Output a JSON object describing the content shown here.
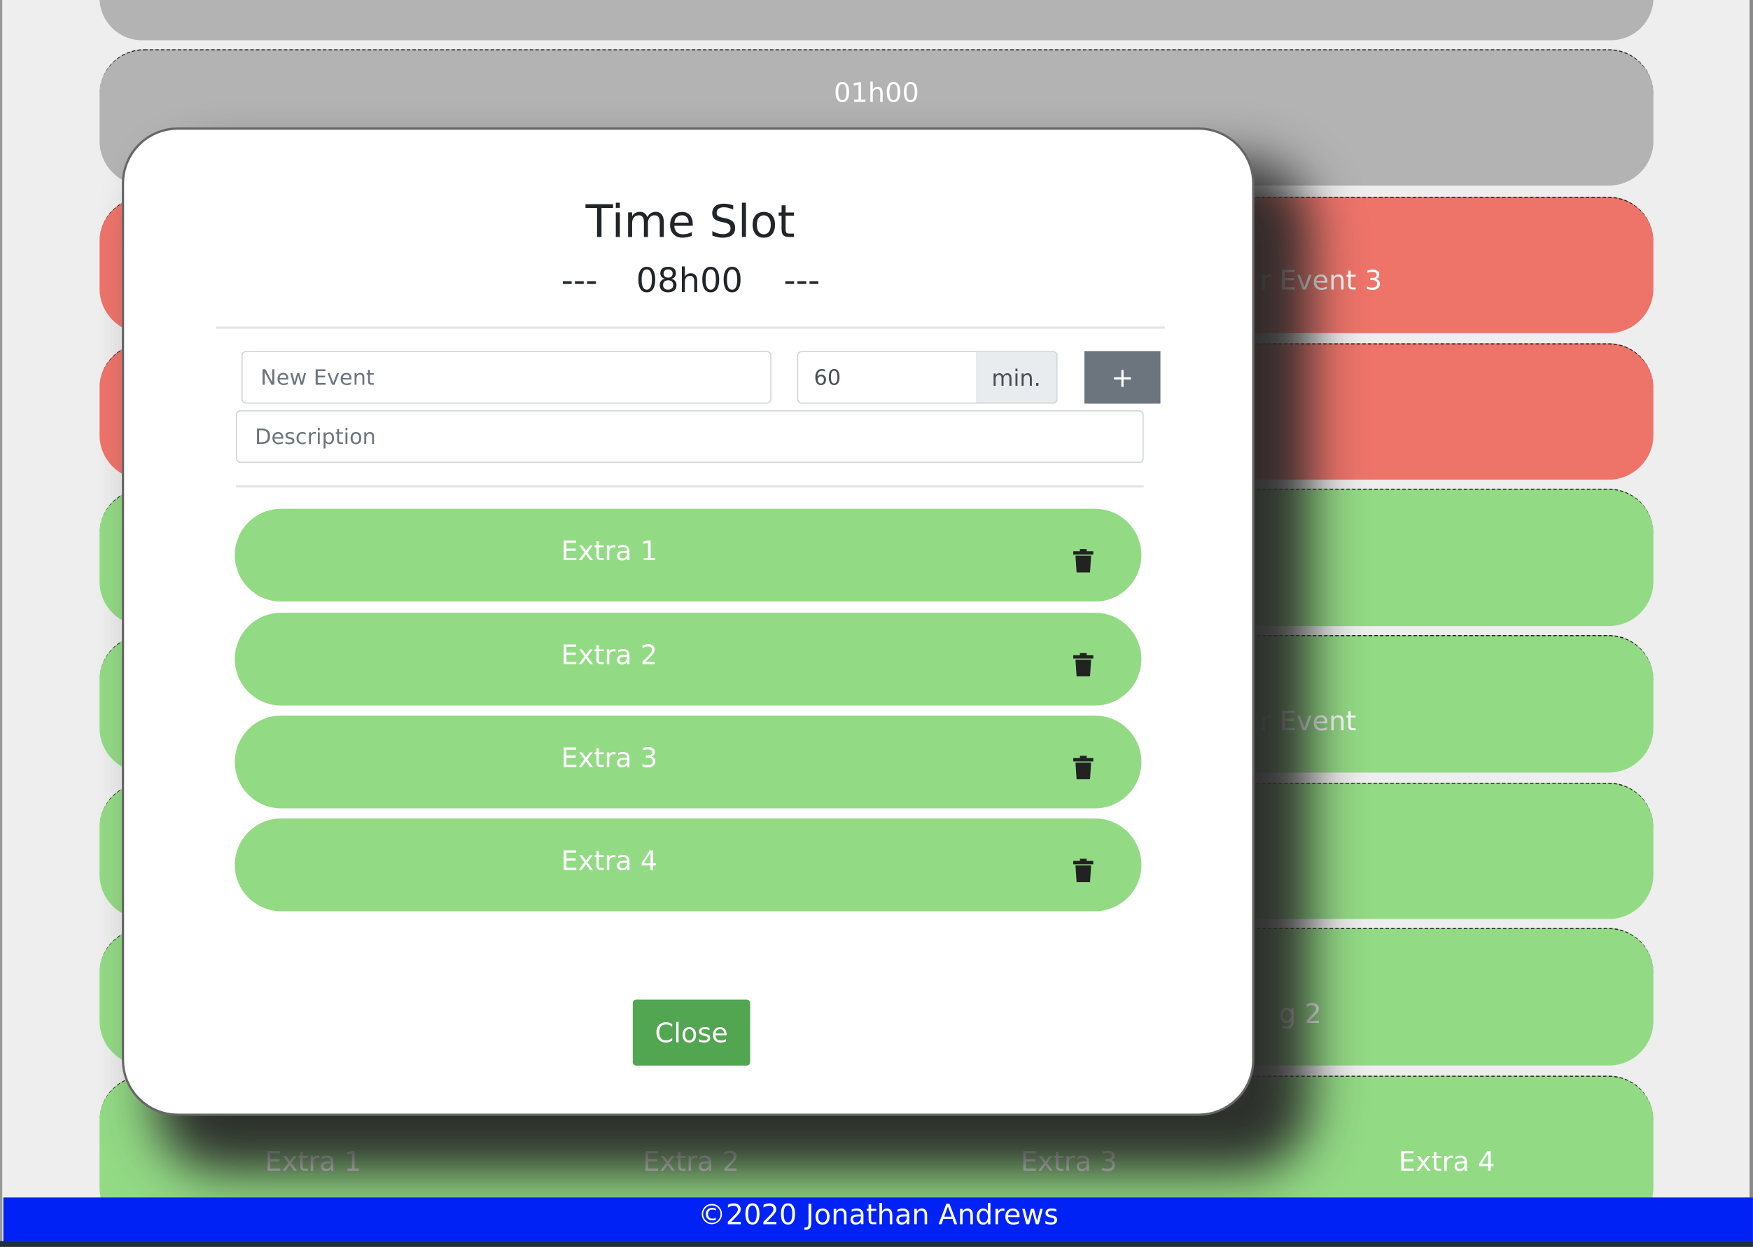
{
  "background": {
    "rows": [
      {
        "color": "gray",
        "text": ""
      },
      {
        "color": "gray",
        "text": "01h00"
      },
      {
        "color": "red",
        "text": "r Event 3"
      },
      {
        "color": "red",
        "text": ""
      },
      {
        "color": "green",
        "text": ""
      },
      {
        "color": "green",
        "text": "r Event"
      },
      {
        "color": "green",
        "text": ""
      },
      {
        "color": "green",
        "text": "g 2"
      }
    ],
    "last_row": [
      "Extra 1",
      "Extra 2",
      "Extra 3",
      "Extra 4"
    ]
  },
  "modal": {
    "title": "Time Slot",
    "subtitle_left": "---",
    "time": "08h00",
    "subtitle_right": "---",
    "name_placeholder": "New Event",
    "duration_value": "60",
    "duration_unit": "min.",
    "add_label": "+",
    "description_placeholder": "Description",
    "events": [
      {
        "label": "Extra 1",
        "icon": "trash-icon"
      },
      {
        "label": "Extra 2",
        "icon": "trash-icon"
      },
      {
        "label": "Extra 3",
        "icon": "trash-icon"
      },
      {
        "label": "Extra 4",
        "icon": "trash-icon"
      }
    ],
    "close_label": "Close"
  },
  "footer": {
    "text": "©2020 Jonathan Andrews"
  },
  "colors": {
    "green": "#93da85",
    "red": "#ee746a",
    "gray": "#b3b3b3",
    "footer": "#0022f5",
    "close": "#52a551",
    "add": "#6c757d"
  }
}
